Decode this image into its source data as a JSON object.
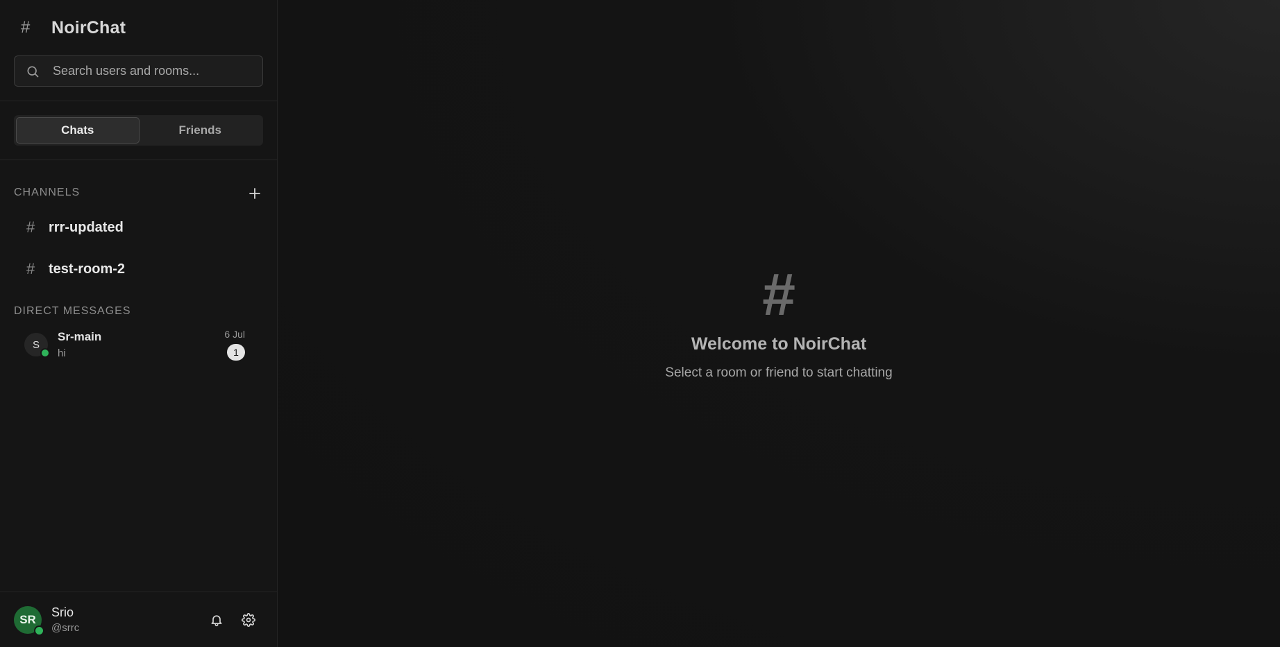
{
  "app": {
    "title": "NoirChat"
  },
  "search": {
    "placeholder": "Search users and rooms..."
  },
  "tabs": [
    {
      "label": "Chats",
      "active": true
    },
    {
      "label": "Friends",
      "active": false
    }
  ],
  "channels": {
    "label": "CHANNELS",
    "items": [
      {
        "name": "rrr-updated"
      },
      {
        "name": "test-room-2"
      }
    ]
  },
  "direct_messages": {
    "label": "DIRECT MESSAGES",
    "items": [
      {
        "initial": "S",
        "name": "Sr-main",
        "last_message": "hi",
        "date": "6 Jul",
        "unread": "1",
        "status": "online"
      }
    ]
  },
  "current_user": {
    "initials": "SR",
    "name": "Srio",
    "handle": "@srrc",
    "status": "online"
  },
  "welcome": {
    "icon": "#",
    "title": "Welcome to NoirChat",
    "subtitle": "Select a room or friend to start chatting"
  },
  "colors": {
    "online": "#2fb35a",
    "user_avatar": "#1f6b34"
  },
  "icons": [
    "hash-icon",
    "search-icon",
    "plus-icon",
    "bell-icon",
    "gear-icon"
  ]
}
